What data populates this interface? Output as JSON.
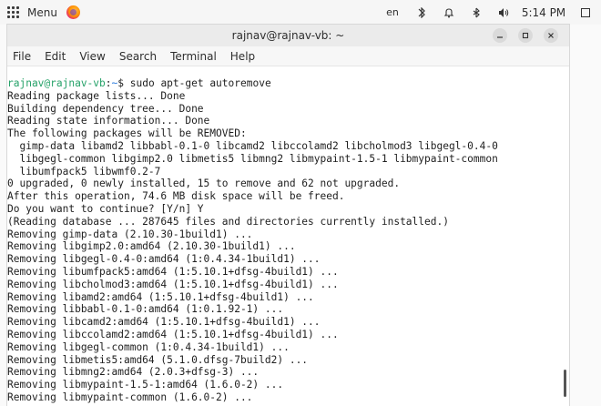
{
  "top_panel": {
    "menu_label": "Menu",
    "lang": "en",
    "clock": "5:14 PM"
  },
  "window": {
    "title": "rajnav@rajnav-vb: ~",
    "menus": [
      "File",
      "Edit",
      "View",
      "Search",
      "Terminal",
      "Help"
    ]
  },
  "terminal": {
    "prompt_user": "rajnav@rajnav-vb",
    "prompt_path": "~",
    "prompt_suffix": "$ ",
    "command": "sudo apt-get autoremove",
    "lines": [
      "Reading package lists... Done",
      "Building dependency tree... Done",
      "Reading state information... Done",
      "The following packages will be REMOVED:",
      "  gimp-data libamd2 libbabl-0.1-0 libcamd2 libccolamd2 libcholmod3 libgegl-0.4-0",
      "  libgegl-common libgimp2.0 libmetis5 libmng2 libmypaint-1.5-1 libmypaint-common",
      "  libumfpack5 libwmf0.2-7",
      "0 upgraded, 0 newly installed, 15 to remove and 62 not upgraded.",
      "After this operation, 74.6 MB disk space will be freed.",
      "Do you want to continue? [Y/n] Y",
      "(Reading database ... 287645 files and directories currently installed.)",
      "Removing gimp-data (2.10.30-1build1) ...",
      "Removing libgimp2.0:amd64 (2.10.30-1build1) ...",
      "Removing libgegl-0.4-0:amd64 (1:0.4.34-1build1) ...",
      "Removing libumfpack5:amd64 (1:5.10.1+dfsg-4build1) ...",
      "Removing libcholmod3:amd64 (1:5.10.1+dfsg-4build1) ...",
      "Removing libamd2:amd64 (1:5.10.1+dfsg-4build1) ...",
      "Removing libbabl-0.1-0:amd64 (1:0.1.92-1) ...",
      "Removing libcamd2:amd64 (1:5.10.1+dfsg-4build1) ...",
      "Removing libccolamd2:amd64 (1:5.10.1+dfsg-4build1) ...",
      "Removing libgegl-common (1:0.4.34-1build1) ...",
      "Removing libmetis5:amd64 (5.1.0.dfsg-7build2) ...",
      "Removing libmng2:amd64 (2.0.3+dfsg-3) ...",
      "Removing libmypaint-1.5-1:amd64 (1.6.0-2) ...",
      "Removing libmypaint-common (1.6.0-2) ..."
    ]
  }
}
